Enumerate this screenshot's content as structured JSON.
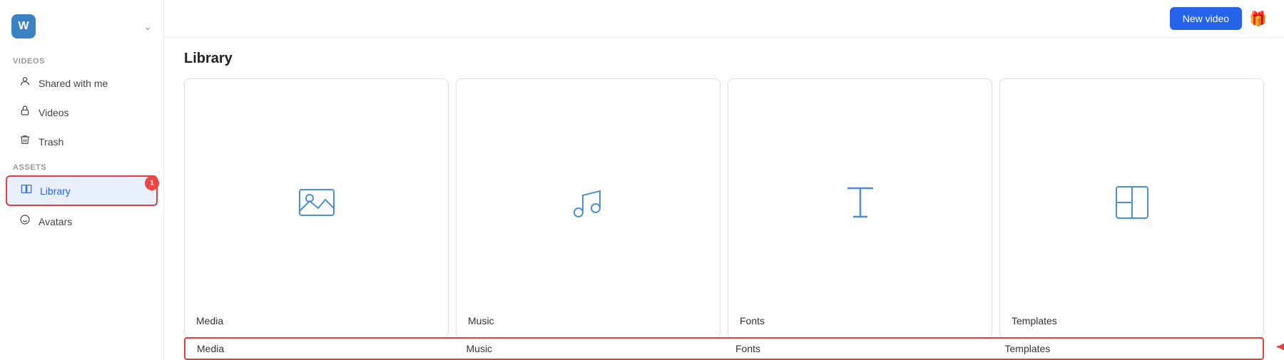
{
  "sidebar": {
    "logo": "W",
    "sections": [
      {
        "label": "Videos",
        "items": [
          {
            "id": "shared-with-me",
            "label": "Shared with me",
            "icon": "person",
            "active": false
          },
          {
            "id": "videos",
            "label": "Videos",
            "icon": "lock",
            "active": false
          },
          {
            "id": "trash",
            "label": "Trash",
            "icon": "trash",
            "active": false
          }
        ]
      },
      {
        "label": "Assets",
        "items": [
          {
            "id": "library",
            "label": "Library",
            "icon": "book-open",
            "active": true,
            "badge": "1"
          },
          {
            "id": "avatars",
            "label": "Avatars",
            "icon": "smiley",
            "active": false
          }
        ]
      }
    ]
  },
  "topbar": {
    "new_video_label": "New video",
    "gift_icon": "🎁"
  },
  "main": {
    "page_title": "Library",
    "cards": [
      {
        "id": "media",
        "label": "Media",
        "icon": "image"
      },
      {
        "id": "music",
        "label": "Music",
        "icon": "music"
      },
      {
        "id": "fonts",
        "label": "Fonts",
        "icon": "font"
      },
      {
        "id": "templates",
        "label": "Templates",
        "icon": "template"
      }
    ]
  }
}
